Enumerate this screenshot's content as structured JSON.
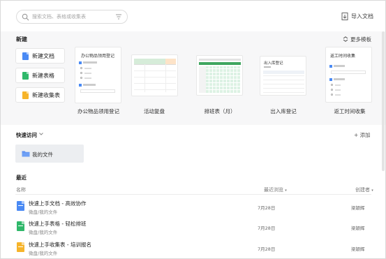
{
  "search": {
    "placeholder": "搜索文档、表格或收集表"
  },
  "header": {
    "import_label": "导入文档"
  },
  "new_section": {
    "title": "新建",
    "more_templates": "更多模板",
    "buttons": [
      {
        "label": "新建文档",
        "color": "#4a8af4"
      },
      {
        "label": "新建表格",
        "color": "#2fb86a"
      },
      {
        "label": "新建收集表",
        "color": "#f6b42a"
      }
    ],
    "templates": [
      {
        "name": "办公物品领用登记",
        "preview_title": "办公物品领用登记"
      },
      {
        "name": "活动复盘"
      },
      {
        "name": "排班表（月）"
      },
      {
        "name": "出入库登记",
        "preview_title": "出入库登记"
      },
      {
        "name": "返工时间收集",
        "preview_title": "返工时间收集"
      }
    ]
  },
  "quick_access": {
    "title": "快速访问",
    "add_label": "+ 添加",
    "folder": "我的文件"
  },
  "recent": {
    "title": "最近",
    "col_name": "名称",
    "col_recent": "最近浏览",
    "col_creator": "创建者",
    "rows": [
      {
        "title": "快速上手文档 - 高效协作",
        "path": "微盘/我的文件",
        "date": "7月28日",
        "creator": "梁颖辉",
        "color": "#4a8af4"
      },
      {
        "title": "快速上手表格 - 轻松排班",
        "path": "微盘/我的文件",
        "date": "7月28日",
        "creator": "梁颖辉",
        "color": "#2fb86a"
      },
      {
        "title": "快速上手收集表 - 培训报名",
        "path": "微盘/我的文件",
        "date": "7月28日",
        "creator": "梁颖辉",
        "color": "#f6b42a"
      }
    ]
  }
}
